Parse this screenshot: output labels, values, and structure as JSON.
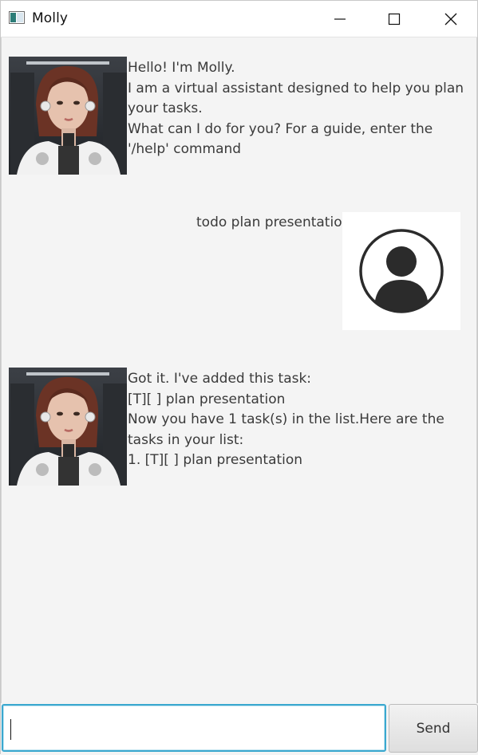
{
  "window": {
    "title": "Molly",
    "controls": [
      "minimize-icon",
      "maximize-icon",
      "close-icon"
    ]
  },
  "conversation": [
    {
      "sender": "bot",
      "avatar": "robot-woman-avatar",
      "text": "Hello! I'm Molly.\nI am a virtual assistant designed to help you plan your tasks.\nWhat can I do for you? For a guide, enter the '/help' command"
    },
    {
      "sender": "user",
      "avatar": "user-profile-icon",
      "text": "todo plan presentation"
    },
    {
      "sender": "bot",
      "avatar": "robot-woman-avatar",
      "text": "Got it. I've added this task:\n[T][ ] plan presentation\nNow you have 1 task(s) in the list.Here are the tasks in your list:\n1. [T][ ] plan presentation"
    }
  ],
  "input": {
    "value": "",
    "placeholder": ""
  },
  "send_button": {
    "label": "Send"
  },
  "colors": {
    "dialog_background": "#f4f4f4",
    "input_focus_border": "#3aa8cf",
    "text": "#3a3a3a"
  }
}
